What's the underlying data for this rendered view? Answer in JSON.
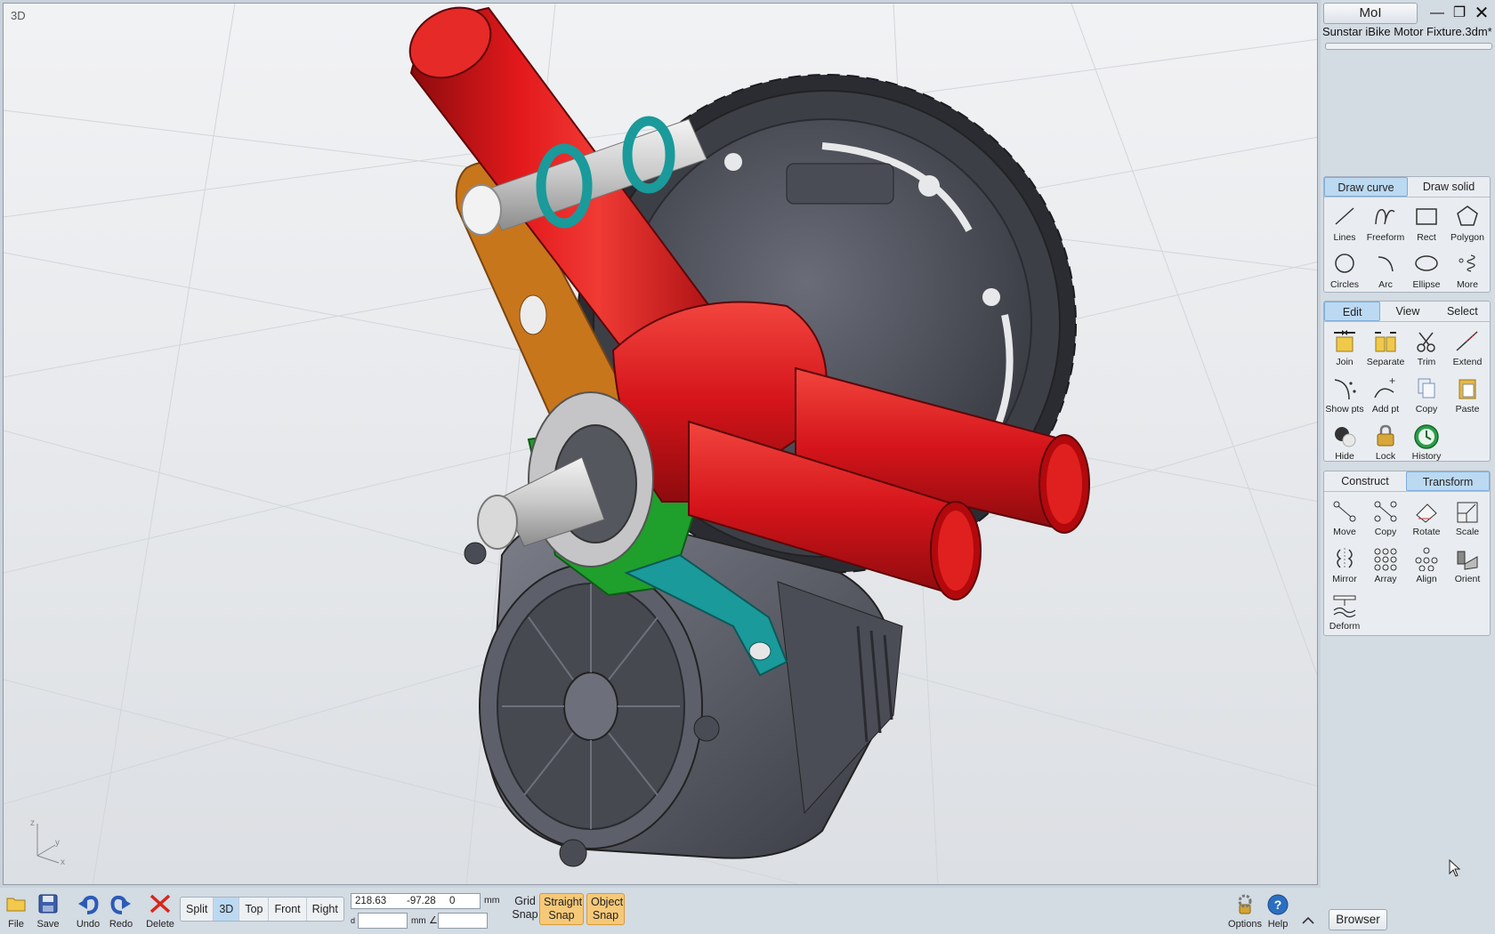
{
  "viewport": {
    "label": "3D",
    "axes": {
      "z": "z",
      "y": "y",
      "x": "x"
    }
  },
  "window": {
    "app_name": "MoI",
    "filename": "Sunstar iBike Motor Fixture.3dm*"
  },
  "draw_panel": {
    "tabs": [
      {
        "label": "Draw curve",
        "active": true
      },
      {
        "label": "Draw solid",
        "active": false
      }
    ],
    "tools": [
      "Lines",
      "Freeform",
      "Rect",
      "Polygon",
      "Circles",
      "Arc",
      "Ellipse",
      "More"
    ]
  },
  "edit_panel": {
    "tabs": [
      {
        "label": "Edit",
        "active": true
      },
      {
        "label": "View",
        "active": false
      },
      {
        "label": "Select",
        "active": false
      }
    ],
    "tools": [
      "Join",
      "Separate",
      "Trim",
      "Extend",
      "Show pts",
      "Add pt",
      "Copy",
      "Paste",
      "Hide",
      "Lock",
      "History"
    ]
  },
  "transform_panel": {
    "tabs": [
      {
        "label": "Construct",
        "active": false
      },
      {
        "label": "Transform",
        "active": true
      }
    ],
    "tools": [
      "Move",
      "Copy",
      "Rotate",
      "Scale",
      "Mirror",
      "Array",
      "Align",
      "Orient",
      "Deform"
    ]
  },
  "toolbar": {
    "file": "File",
    "save": "Save",
    "undo": "Undo",
    "redo": "Redo",
    "delete": "Delete",
    "views": [
      {
        "label": "Split",
        "active": false
      },
      {
        "label": "3D",
        "active": true
      },
      {
        "label": "Top",
        "active": false
      },
      {
        "label": "Front",
        "active": false
      },
      {
        "label": "Right",
        "active": false
      }
    ],
    "coords": {
      "x": "218.63",
      "y": "-97.28",
      "z": "0",
      "unit": "mm",
      "d_label": "d",
      "d_unit": "mm",
      "angle_label": "∠"
    },
    "grid_snap": {
      "line1": "Grid",
      "line2": "Snap"
    },
    "straight_snap": {
      "line1": "Straight",
      "line2": "Snap"
    },
    "object_snap": {
      "line1": "Object",
      "line2": "Snap"
    },
    "options": "Options",
    "help": "Help",
    "browser": "Browser"
  },
  "colors": {
    "frame_red": "#d8161a",
    "arm_orange": "#c8761c",
    "bracket_teal": "#1a9a9a",
    "plate_green": "#1f9f2c",
    "motor_grey": "#5a5c66",
    "active_tab": "#bcd9f2",
    "snap_on": "#f6c979"
  }
}
